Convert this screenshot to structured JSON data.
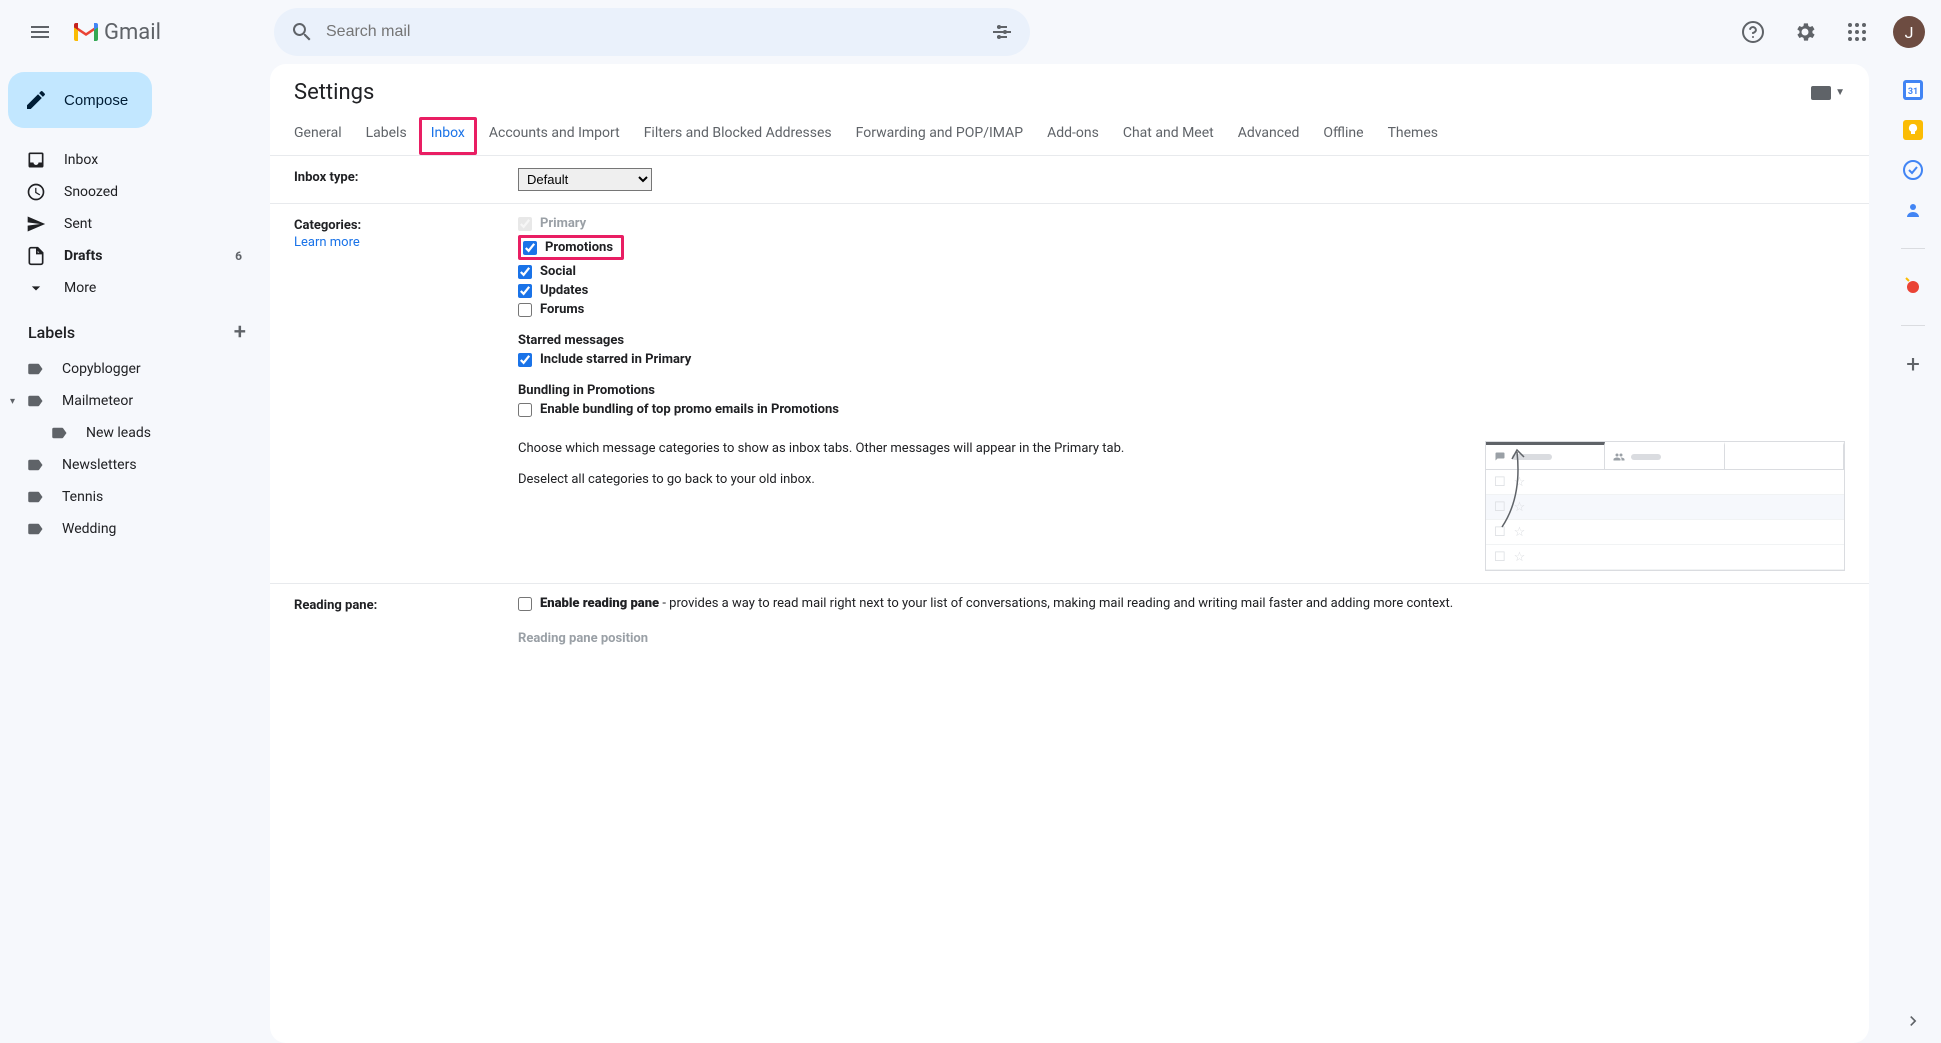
{
  "header": {
    "product_name": "Gmail",
    "search_placeholder": "Search mail",
    "avatar_initial": "J"
  },
  "sidebar": {
    "compose_label": "Compose",
    "items": [
      {
        "label": "Inbox",
        "icon": "inbox",
        "bold": false,
        "count": ""
      },
      {
        "label": "Snoozed",
        "icon": "clock",
        "bold": false,
        "count": ""
      },
      {
        "label": "Sent",
        "icon": "send",
        "bold": false,
        "count": ""
      },
      {
        "label": "Drafts",
        "icon": "file",
        "bold": true,
        "count": "6"
      },
      {
        "label": "More",
        "icon": "chevron-down",
        "bold": false,
        "count": ""
      }
    ],
    "labels_heading": "Labels",
    "labels": [
      {
        "label": "Copyblogger",
        "expandable": false,
        "child": false
      },
      {
        "label": "Mailmeteor",
        "expandable": true,
        "child": false
      },
      {
        "label": "New leads",
        "expandable": false,
        "child": true
      },
      {
        "label": "Newsletters",
        "expandable": false,
        "child": false
      },
      {
        "label": "Tennis",
        "expandable": false,
        "child": false
      },
      {
        "label": "Wedding",
        "expandable": false,
        "child": false
      }
    ]
  },
  "settings": {
    "title": "Settings",
    "tabs": [
      "General",
      "Labels",
      "Inbox",
      "Accounts and Import",
      "Filters and Blocked Addresses",
      "Forwarding and POP/IMAP",
      "Add-ons",
      "Chat and Meet",
      "Advanced",
      "Offline",
      "Themes"
    ],
    "active_tab": "Inbox",
    "inbox_type": {
      "label": "Inbox type:",
      "value": "Default"
    },
    "categories": {
      "label": "Categories:",
      "learn_more": "Learn more",
      "items": [
        {
          "label": "Primary",
          "checked": true,
          "disabled": true,
          "highlight": false
        },
        {
          "label": "Promotions",
          "checked": true,
          "disabled": false,
          "highlight": true
        },
        {
          "label": "Social",
          "checked": true,
          "disabled": false,
          "highlight": false
        },
        {
          "label": "Updates",
          "checked": true,
          "disabled": false,
          "highlight": false
        },
        {
          "label": "Forums",
          "checked": false,
          "disabled": false,
          "highlight": false
        }
      ],
      "starred_heading": "Starred messages",
      "starred_label": "Include starred in Primary",
      "starred_checked": true,
      "bundling_heading": "Bundling in Promotions",
      "bundling_label": "Enable bundling of top promo emails in Promotions",
      "bundling_checked": false,
      "desc1": "Choose which message categories to show as inbox tabs. Other messages will appear in the Primary tab.",
      "desc2": "Deselect all categories to go back to your old inbox."
    },
    "reading_pane": {
      "label": "Reading pane:",
      "enable_label": "Enable reading pane",
      "enable_desc": " - provides a way to read mail right next to your list of conversations, making mail reading and writing mail faster and adding more context.",
      "enable_checked": false,
      "position_label": "Reading pane position"
    }
  }
}
